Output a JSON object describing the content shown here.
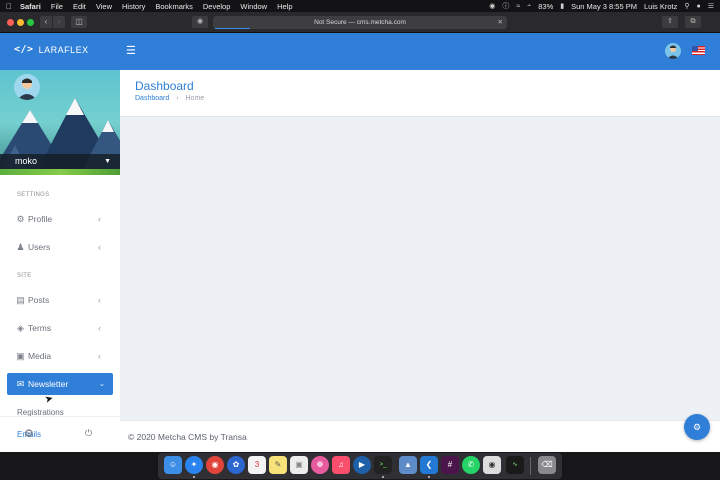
{
  "menubar": {
    "app": "Safari",
    "menus": [
      "File",
      "Edit",
      "View",
      "History",
      "Bookmarks",
      "Develop",
      "Window",
      "Help"
    ],
    "battery": "83%",
    "clock": "Sun May 3  8:55 PM",
    "user": "Luis Krotz"
  },
  "browser": {
    "url": "Not Secure — cms.metcha.com",
    "load_progress": 0.12
  },
  "app": {
    "logo_text": "LARAFLEX",
    "sidebar": {
      "user_name": "moko",
      "sections": {
        "settings": "SETTINGS",
        "site": "SITE"
      },
      "items": [
        {
          "label": "Profile",
          "icon": "user-cog-icon"
        },
        {
          "label": "Users",
          "icon": "users-icon"
        },
        {
          "label": "Posts",
          "icon": "newspaper-icon"
        },
        {
          "label": "Terms",
          "icon": "tag-icon"
        },
        {
          "label": "Media",
          "icon": "image-icon"
        },
        {
          "label": "Newsletter",
          "icon": "envelope-icon",
          "active": true
        }
      ],
      "sub_items": [
        {
          "label": "Registrations"
        },
        {
          "label": "Emails",
          "active": true
        }
      ]
    },
    "header": {
      "title": "Dashboard",
      "breadcrumb": [
        "Dashboard",
        "Home"
      ]
    },
    "footer": {
      "text": "© 2020 Metcha CMS by Transa"
    }
  },
  "colors": {
    "primary": "#2f7fd8",
    "background": "#edf1f5",
    "sidebar": "#ffffff"
  }
}
